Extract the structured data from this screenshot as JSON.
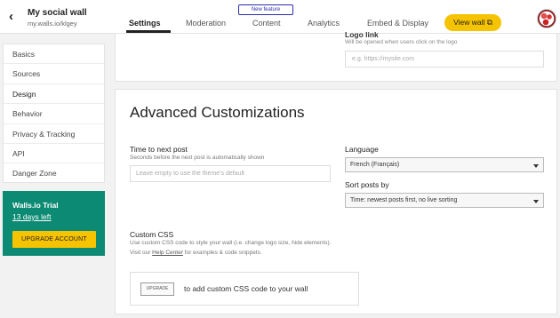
{
  "header": {
    "back_icon": "chevron-left-icon",
    "wall_name": "My social wall",
    "wall_url": "my.walls.io/klgey",
    "tabs": [
      {
        "label": "Settings",
        "active": true
      },
      {
        "label": "Moderation",
        "active": false
      },
      {
        "label": "Content",
        "active": false
      },
      {
        "label": "Analytics",
        "active": false
      },
      {
        "label": "Embed & Display",
        "active": false
      }
    ],
    "new_feature_badge": "New feature",
    "view_wall_label": "View wall ⧉",
    "accent_color": "#f6c300"
  },
  "sidebar": {
    "items": [
      {
        "label": "Basics"
      },
      {
        "label": "Sources"
      },
      {
        "label": "Design"
      },
      {
        "label": "Behavior"
      },
      {
        "label": "Privacy & Tracking"
      },
      {
        "label": "API"
      },
      {
        "label": "Danger Zone"
      }
    ],
    "trial": {
      "title": "Walls.io Trial",
      "days_left": "13 days left",
      "upgrade_label": "UPGRADE ACCOUNT",
      "background_color": "#0c8a73"
    }
  },
  "logo_link": {
    "label": "Logo link",
    "description": "Will be opened when users click on the logo",
    "placeholder": "e.g. https://mysite.com"
  },
  "advanced": {
    "title": "Advanced Customizations",
    "time_to_next_post": {
      "label": "Time to next post",
      "description": "Seconds before the next post is automatically shown",
      "placeholder": "Leave empty to use the theme's default"
    },
    "language": {
      "label": "Language",
      "selected": "French (Français)"
    },
    "sort_posts_by": {
      "label": "Sort posts by",
      "selected": "Time: newest posts first, no live sorting"
    },
    "custom_css": {
      "label": "Custom CSS",
      "description_line1": "Use custom CSS code to style your wall (i.e. change logo size, hide elements).",
      "description_prefix": "Visit our ",
      "help_link": "Help Center",
      "description_suffix": " for examples & code snippets.",
      "upgrade_button": "UPGRADE",
      "upgrade_text": "to add custom CSS code to your wall"
    }
  }
}
